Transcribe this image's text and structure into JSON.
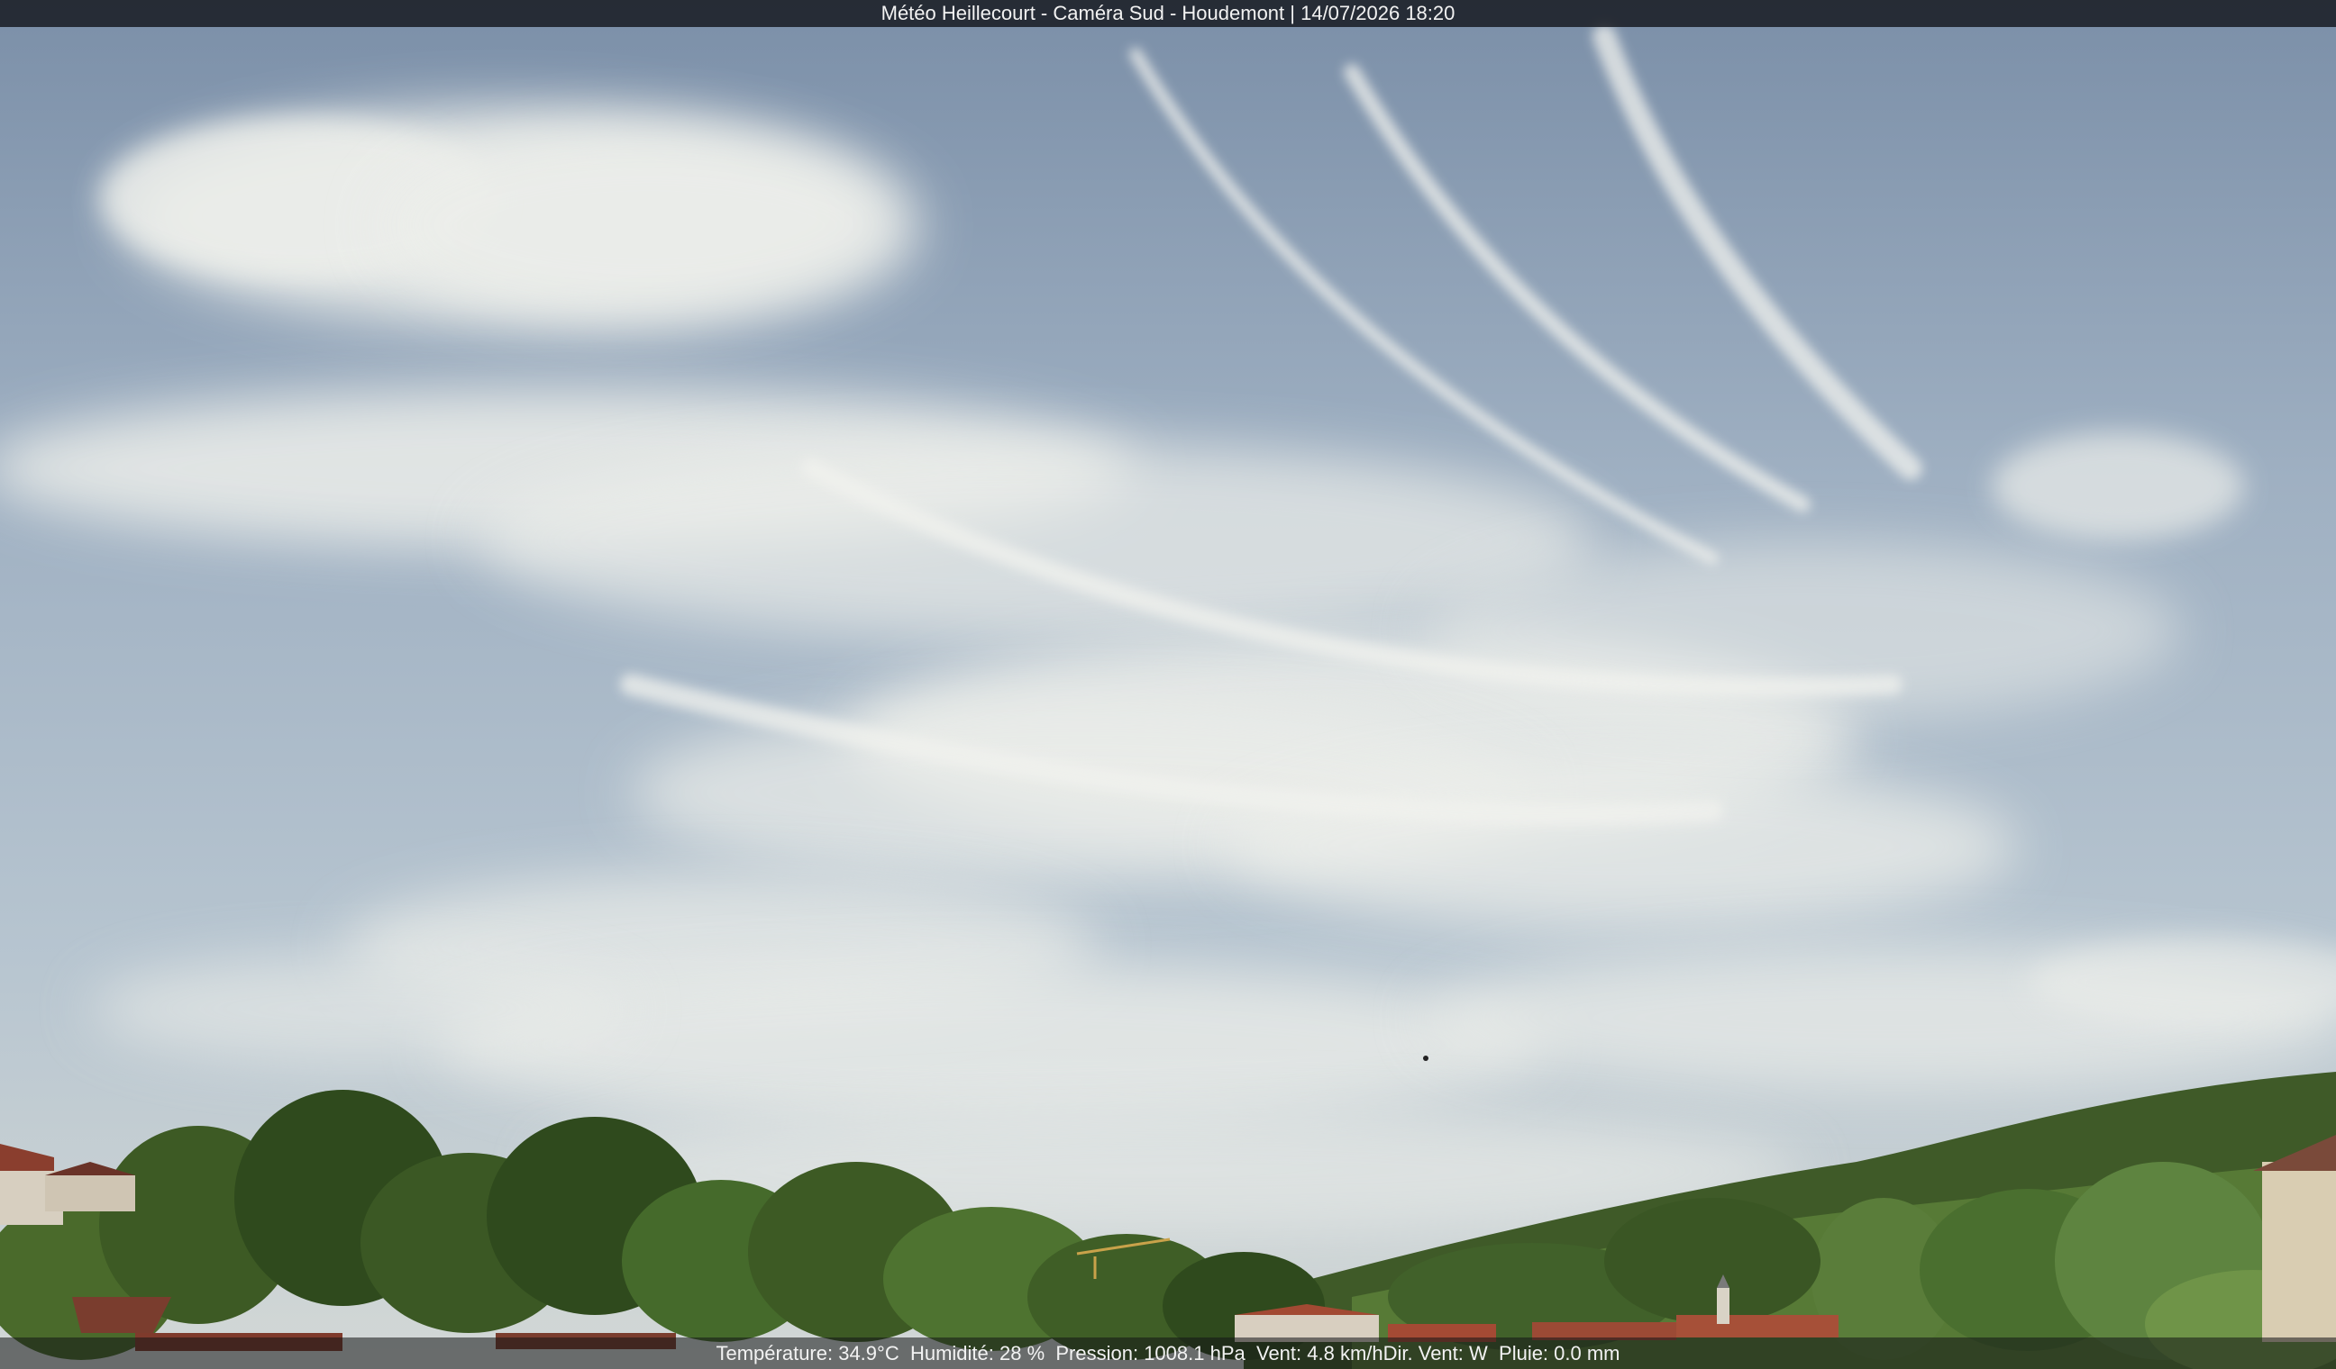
{
  "overlay": {
    "title": "Météo Heillecourt - Caméra Sud - Houdemont | 14/07/2026 18:20",
    "weather": {
      "temperature": "Température: 34.9°C",
      "humidity": "Humidité: 28 %",
      "pressure": "Pression: 1008.1 hPa",
      "wind": "Vent: 4.8 km/h",
      "wind_dir": "Dir. Vent: W",
      "rain": "Pluie: 0.0 mm"
    }
  },
  "colors": {
    "sky_top": "#7d92ab",
    "sky_mid": "#a7b6c6",
    "sky_low": "#c9d2d6",
    "cloud": "#eceeea",
    "tree_dark": "#2c3d1c",
    "tree_mid": "#4b6a2d",
    "tree_light": "#7a9a4b",
    "roof": "#9c4a35"
  }
}
